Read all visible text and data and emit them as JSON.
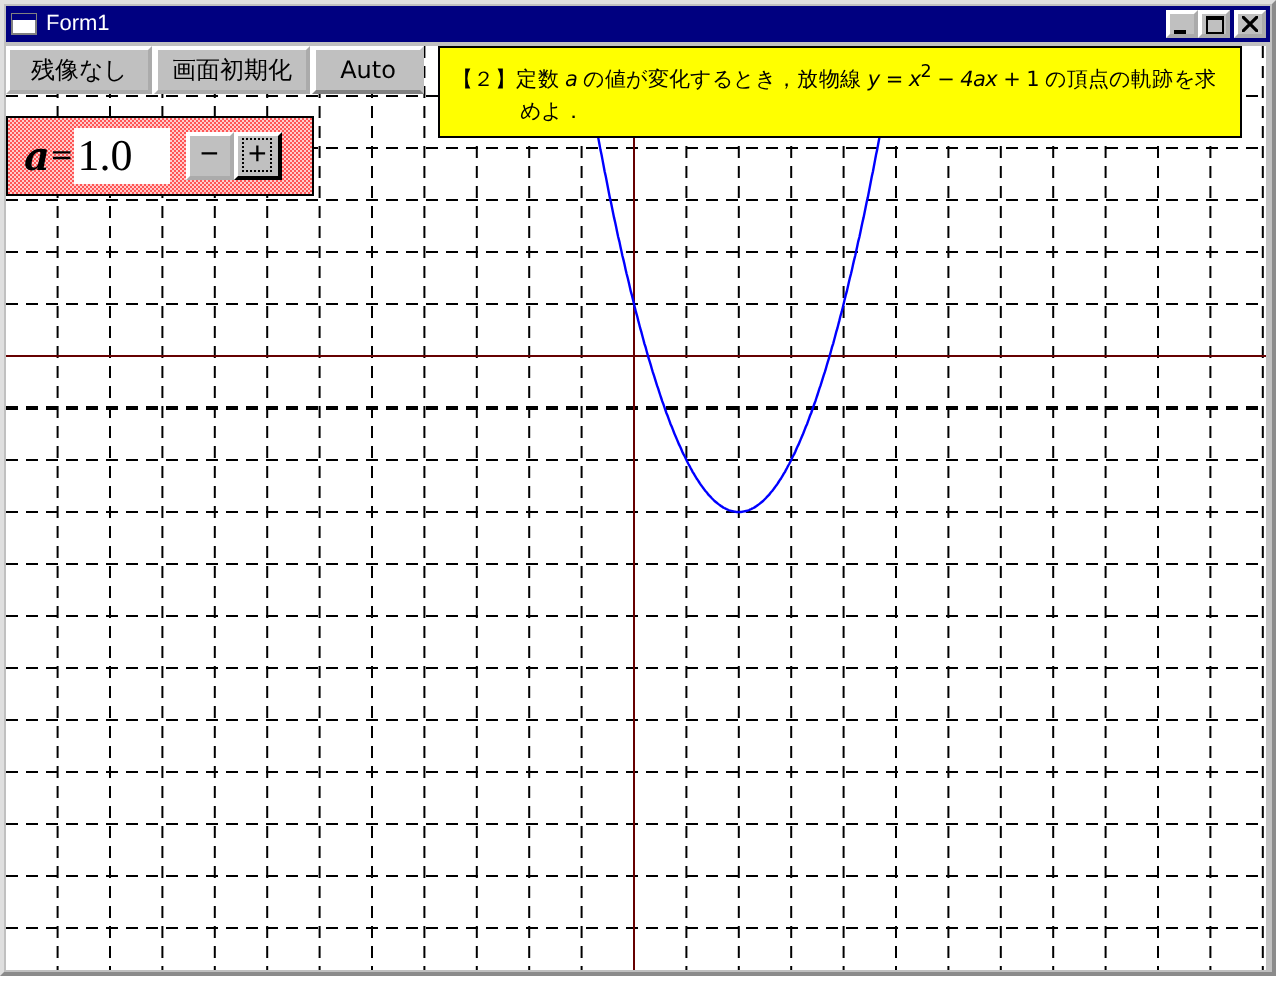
{
  "window": {
    "title": "Form1"
  },
  "toolbar": {
    "buttons": [
      "残像なし",
      "画面初期化",
      "Auto"
    ]
  },
  "problem": {
    "text": "【２】定数 *a* の値が変化するとき，放物線 *y* = *x*$^{2}$ − *4ax* + 1 の頂点の軌跡を求めよ．"
  },
  "parameter": {
    "label": "a",
    "equals": "=",
    "value": "1.0",
    "decrement": "−",
    "increment": "+"
  }
}
